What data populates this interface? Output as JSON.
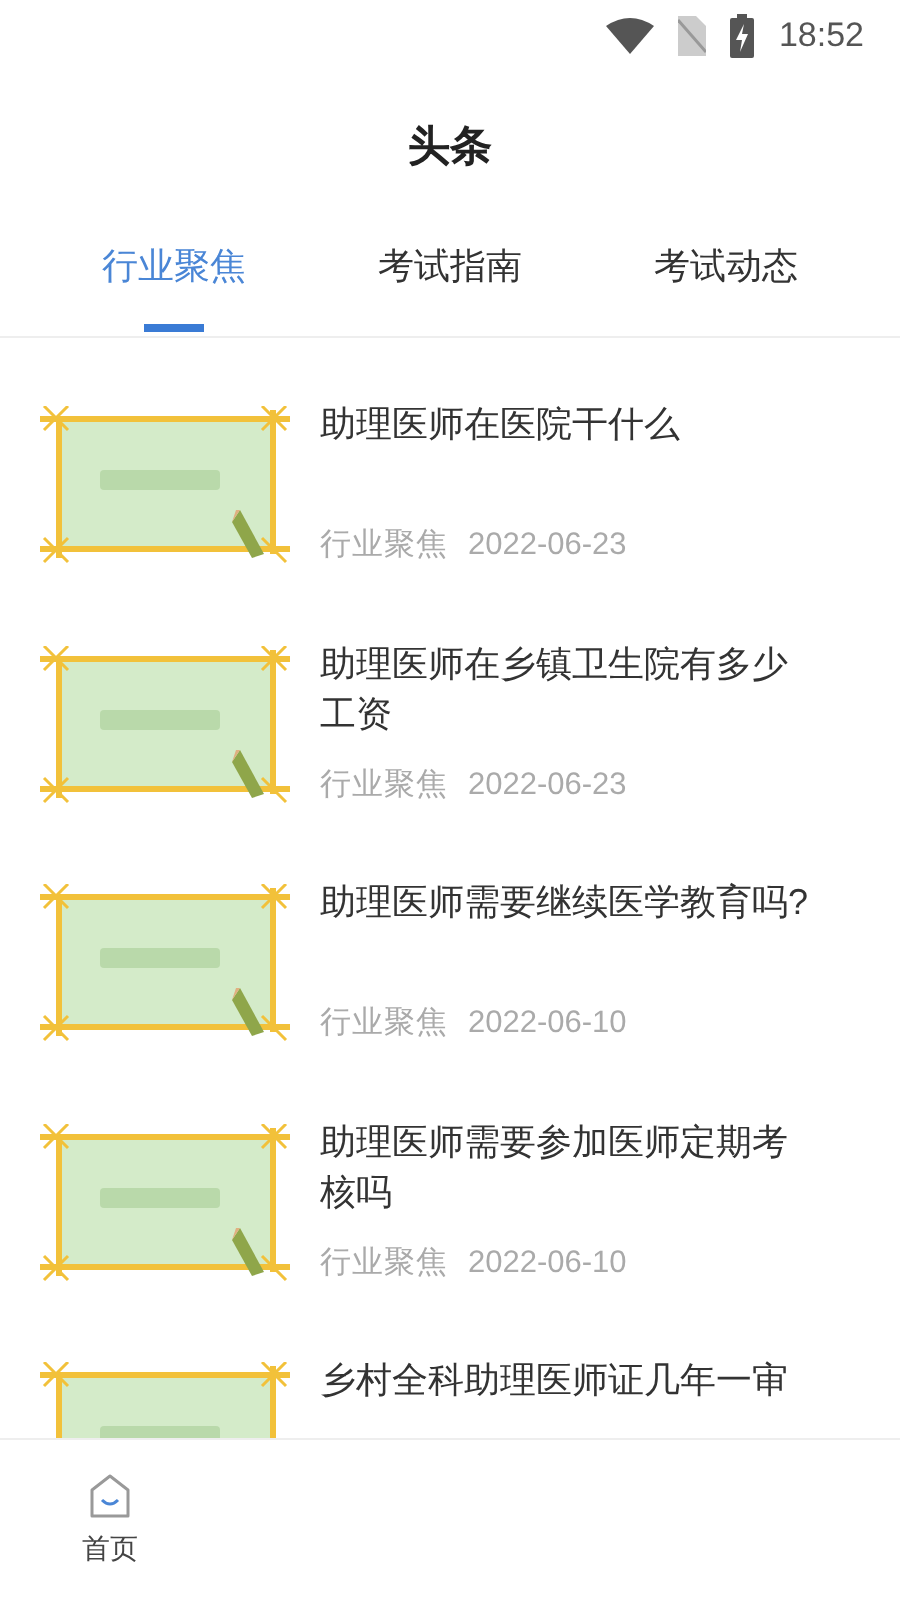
{
  "status_bar": {
    "time": "18:52"
  },
  "header": {
    "title": "头条"
  },
  "tabs": [
    {
      "label": "行业聚焦",
      "selected": true
    },
    {
      "label": "考试指南",
      "selected": false
    },
    {
      "label": "考试动态",
      "selected": false
    }
  ],
  "articles": [
    {
      "title": "助理医师在医院干什么",
      "category": "行业聚焦",
      "date": "2022-06-23"
    },
    {
      "title": "助理医师在乡镇卫生院有多少工资",
      "category": "行业聚焦",
      "date": "2022-06-23"
    },
    {
      "title": "助理医师需要继续医学教育吗?",
      "category": "行业聚焦",
      "date": "2022-06-10"
    },
    {
      "title": "助理医师需要参加医师定期考核吗",
      "category": "行业聚焦",
      "date": "2022-06-10"
    },
    {
      "title": "乡村全科助理医师证几年一审"
    }
  ],
  "bottom_nav": [
    {
      "label": "首页"
    }
  ]
}
